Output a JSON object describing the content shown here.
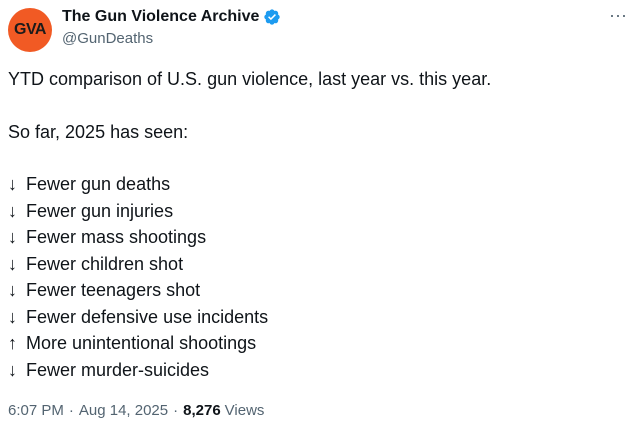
{
  "author": {
    "avatar_text": "GVA",
    "display_name": "The Gun Violence Archive",
    "handle": "@GunDeaths",
    "verified": true,
    "accent_color": "#f15a24",
    "verified_color": "#1d9bf0"
  },
  "tweet": {
    "intro": "YTD comparison of U.S. gun violence, last year vs. this year.",
    "lead": "So far, 2025 has seen:",
    "items": [
      {
        "arrow": "↓",
        "text": "Fewer gun deaths"
      },
      {
        "arrow": "↓",
        "text": "Fewer gun injuries"
      },
      {
        "arrow": "↓",
        "text": "Fewer mass shootings"
      },
      {
        "arrow": "↓",
        "text": "Fewer children shot"
      },
      {
        "arrow": "↓",
        "text": "Fewer teenagers shot"
      },
      {
        "arrow": "↓",
        "text": "Fewer defensive use incidents"
      },
      {
        "arrow": "↑",
        "text": "More unintentional shootings"
      },
      {
        "arrow": "↓",
        "text": "Fewer murder-suicides"
      }
    ]
  },
  "meta": {
    "time": "6:07 PM",
    "date": "Aug 14, 2025",
    "views_count": "8,276",
    "views_label": "Views",
    "separator": "·"
  }
}
